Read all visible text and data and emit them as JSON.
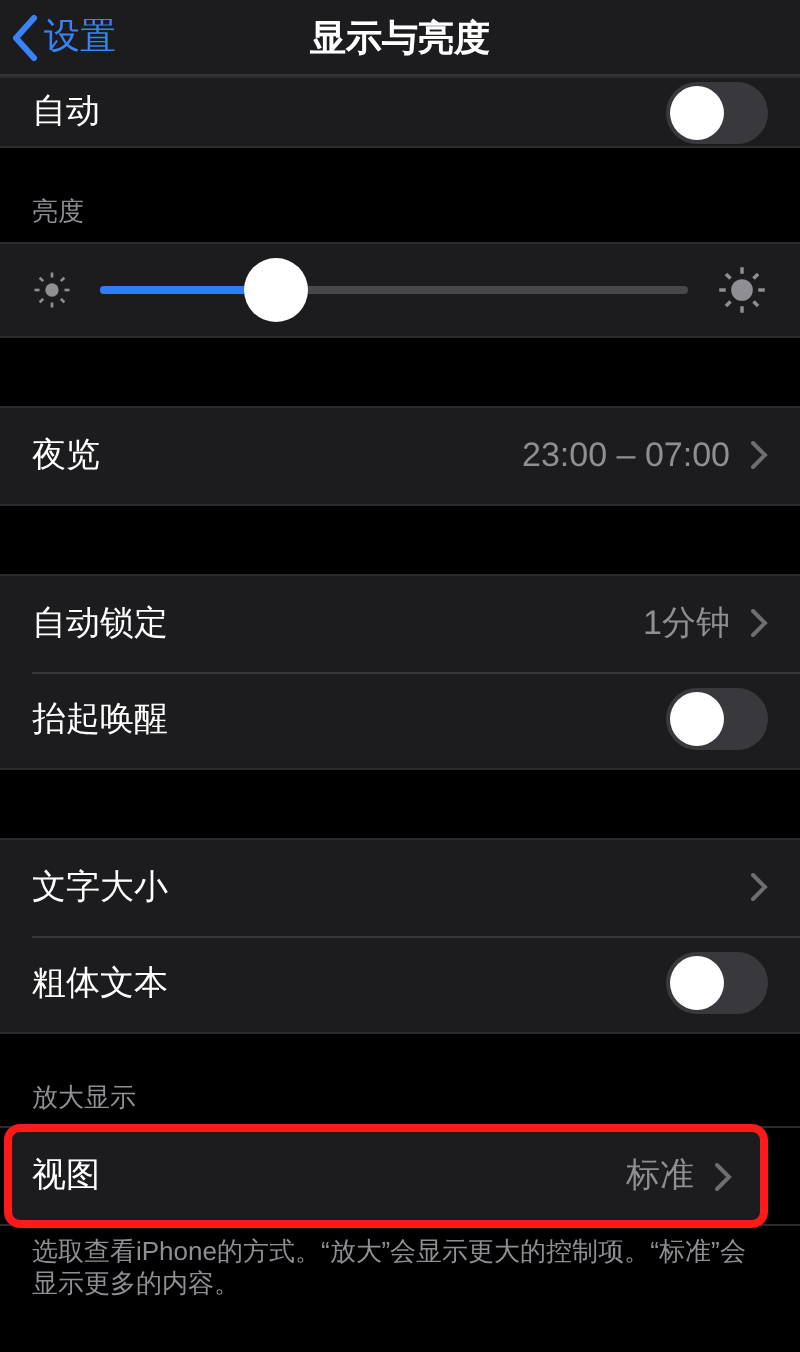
{
  "nav": {
    "back_label": "设置",
    "title": "显示与亮度"
  },
  "sections": [
    {
      "rows": [
        {
          "kind": "toggle",
          "label": "自动",
          "on": false,
          "highlighted": false
        }
      ]
    },
    {
      "header": "亮度",
      "rows": [
        {
          "kind": "slider",
          "level": 0.3,
          "highlighted": false
        }
      ]
    },
    {
      "rows": [
        {
          "kind": "link",
          "label": "夜览",
          "value": "23:00 – 07:00",
          "highlighted": false
        }
      ]
    },
    {
      "rows": [
        {
          "kind": "link",
          "label": "自动锁定",
          "value": "1分钟",
          "highlighted": false
        },
        {
          "kind": "toggle",
          "label": "抬起唤醒",
          "on": false,
          "highlighted": false
        }
      ]
    },
    {
      "rows": [
        {
          "kind": "link",
          "label": "文字大小",
          "highlighted": false
        },
        {
          "kind": "toggle",
          "label": "粗体文本",
          "on": false,
          "highlighted": false
        }
      ]
    },
    {
      "header": "放大显示",
      "rows": [
        {
          "kind": "link",
          "label": "视图",
          "value": "标准",
          "highlighted": true
        }
      ],
      "footer": "选取查看iPhone的方式。“放大”会显示更大的控制项。“标准”会显示更多的内容。"
    }
  ]
}
